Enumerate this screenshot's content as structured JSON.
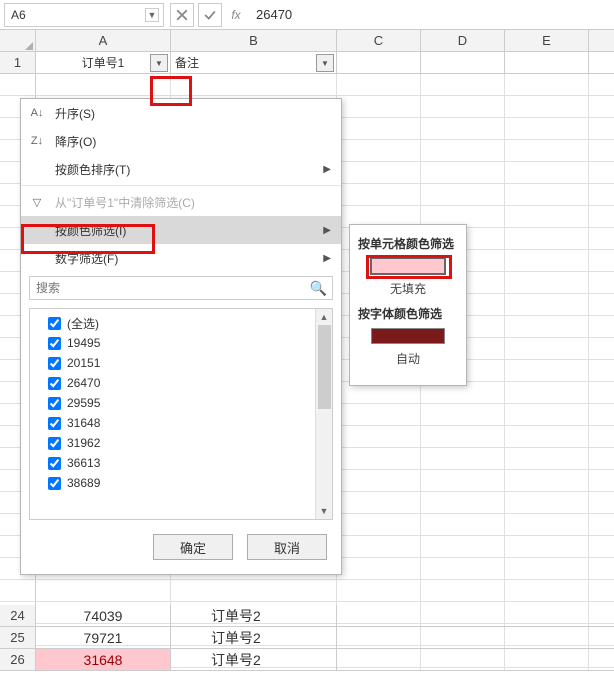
{
  "formula_bar": {
    "cell_ref": "A6",
    "value": "26470"
  },
  "columns": [
    "A",
    "B",
    "C",
    "D",
    "E"
  ],
  "row1": {
    "num": "1",
    "colA": "订单号1",
    "colB": "备注"
  },
  "menu": {
    "sort_asc": "升序(S)",
    "sort_desc": "降序(O)",
    "sort_color": "按颜色排序(T)",
    "clear_filter": "从\"订单号1\"中清除筛选(C)",
    "filter_color": "按颜色筛选(I)",
    "number_filter": "数字筛选(F)",
    "search_placeholder": "搜索",
    "list": [
      "(全选)",
      "19495",
      "20151",
      "26470",
      "29595",
      "31648",
      "31962",
      "36613",
      "38689"
    ],
    "ok": "确定",
    "cancel": "取消"
  },
  "submenu": {
    "by_cell_color": "按单元格颜色筛选",
    "no_fill": "无填充",
    "by_font_color": "按字体颜色筛选",
    "auto": "自动"
  },
  "bottom": {
    "rows": [
      {
        "num": "24",
        "a": "74039",
        "b": "订单号2",
        "hl": false
      },
      {
        "num": "25",
        "a": "79721",
        "b": "订单号2",
        "hl": false
      },
      {
        "num": "26",
        "a": "31648",
        "b": "订单号2",
        "hl": true
      }
    ]
  },
  "chart_data": {
    "type": "table",
    "title": "Excel filter dropdown on column 订单号1",
    "visible_rows": [
      {
        "row": 24,
        "订单号1": 74039,
        "备注": "订单号2"
      },
      {
        "row": 25,
        "订单号1": 79721,
        "备注": "订单号2"
      },
      {
        "row": 26,
        "订单号1": 31648,
        "备注": "订单号2"
      }
    ],
    "filter_values": [
      19495,
      20151,
      26470,
      29595,
      31648,
      31962,
      36613,
      38689
    ]
  }
}
